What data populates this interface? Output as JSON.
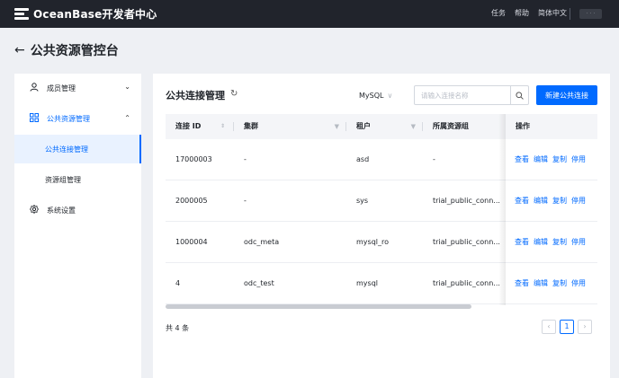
{
  "header": {
    "brand": "OceanBase开发者中心",
    "nav": [
      "任务",
      "帮助",
      "简体中文"
    ],
    "badge": "· · ·"
  },
  "page": {
    "back_icon": "←",
    "title": "公共资源管控台"
  },
  "sidebar": {
    "items": [
      {
        "label": "成员管理",
        "icon": "user-icon",
        "expanded": false
      },
      {
        "label": "公共资源管理",
        "icon": "grid-icon",
        "expanded": true
      },
      {
        "label": "系统设置",
        "icon": "gear-icon",
        "expanded": false
      }
    ],
    "subitems": [
      {
        "label": "公共连接管理",
        "active": true
      },
      {
        "label": "资源组管理",
        "active": false
      }
    ]
  },
  "main": {
    "title": "公共连接管理",
    "db_select": "MySQL",
    "search_placeholder": "请输入连接名称",
    "new_button": "新建公共连接",
    "columns": [
      "连接 ID",
      "集群",
      "租户",
      "所属资源组",
      "操作"
    ],
    "rows": [
      {
        "id": "17000003",
        "cluster": "-",
        "tenant": "asd",
        "group": "-"
      },
      {
        "id": "2000005",
        "cluster": "-",
        "tenant": "sys",
        "group": "trial_public_conn..."
      },
      {
        "id": "1000004",
        "cluster": "odc_meta",
        "tenant": "mysql_ro",
        "group": "trial_public_conn..."
      },
      {
        "id": "4",
        "cluster": "odc_test",
        "tenant": "mysql",
        "group": "trial_public_conn..."
      }
    ],
    "row_actions": [
      "查看",
      "编辑",
      "复制",
      "停用"
    ],
    "total": "共 4 条",
    "current_page": "1"
  },
  "colors": {
    "accent": "#006aff",
    "topbar": "#21242c",
    "background": "#eef0f4"
  }
}
